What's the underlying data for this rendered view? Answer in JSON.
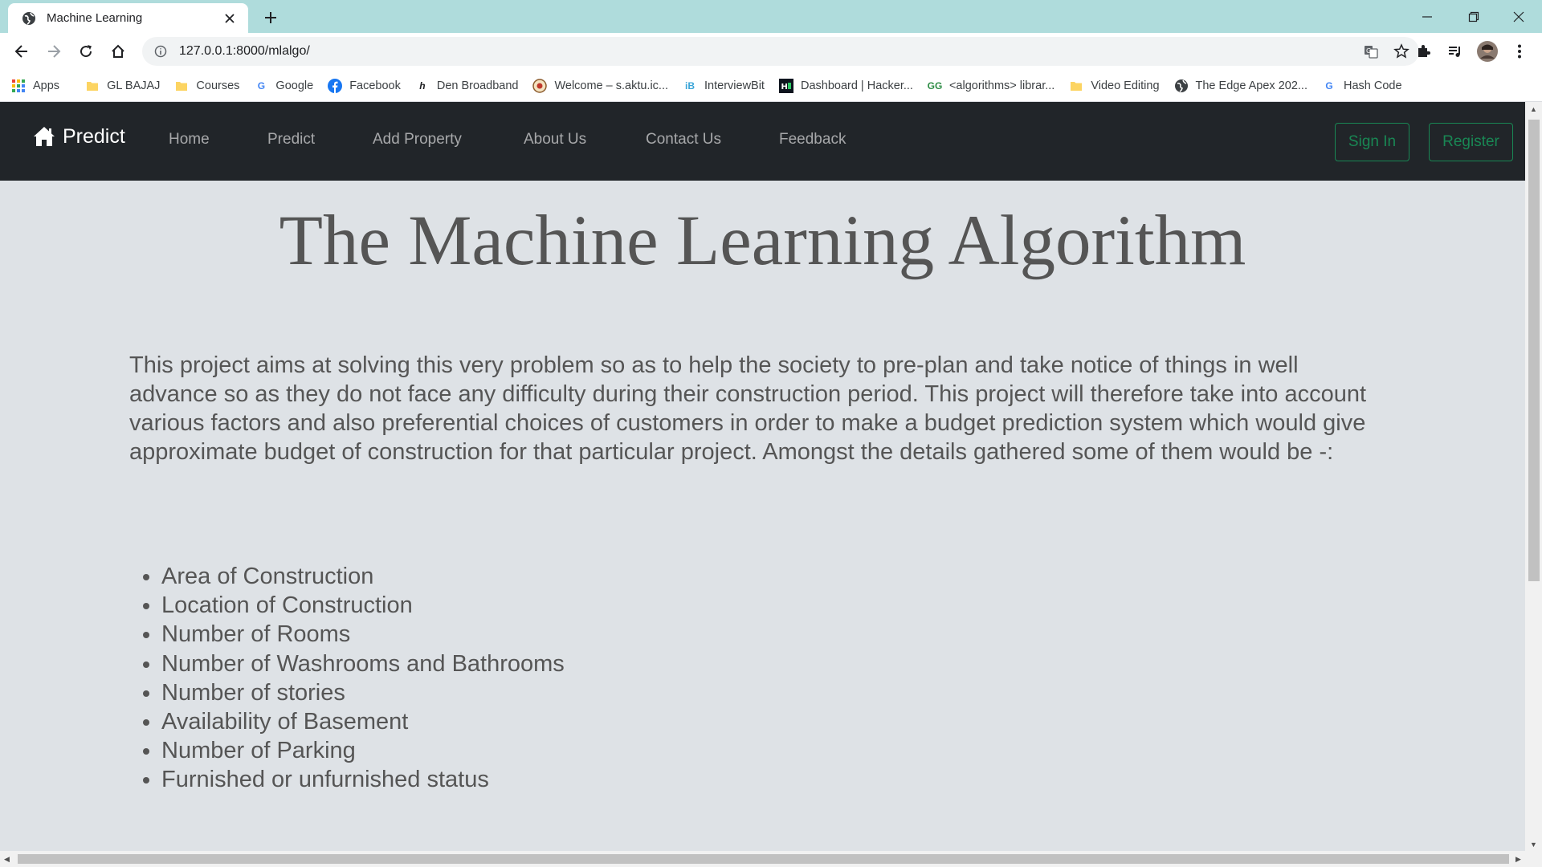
{
  "browser": {
    "tab_title": "Machine Learning",
    "url": "127.0.0.1:8000/mlalgo/",
    "bookmarks": [
      {
        "label": "Apps",
        "icon": "apps-grid-icon"
      },
      {
        "label": "GL BAJAJ",
        "icon": "folder-icon"
      },
      {
        "label": "Courses",
        "icon": "folder-icon"
      },
      {
        "label": "Google",
        "icon": "google-icon"
      },
      {
        "label": "Facebook",
        "icon": "facebook-icon"
      },
      {
        "label": "Den Broadband",
        "icon": "den-icon"
      },
      {
        "label": "Welcome – s.aktu.ic...",
        "icon": "aktu-icon"
      },
      {
        "label": "InterviewBit",
        "icon": "interviewbit-icon"
      },
      {
        "label": "Dashboard | Hacker...",
        "icon": "hackerrank-icon"
      },
      {
        "label": "<algorithms> librar...",
        "icon": "gfg-icon"
      },
      {
        "label": "Video Editing",
        "icon": "folder-icon"
      },
      {
        "label": "The Edge Apex 202...",
        "icon": "globe-icon"
      },
      {
        "label": "Hash Code",
        "icon": "google-icon"
      }
    ]
  },
  "navbar": {
    "brand": "Predict",
    "links": [
      "Home",
      "Predict",
      "Add Property",
      "About Us",
      "Contact Us",
      "Feedback"
    ],
    "signin": "Sign In",
    "register": "Register"
  },
  "main": {
    "title": "The Machine Learning Algorithm",
    "intro": "This project aims at solving this very problem so as to help the society to pre-plan and take notice of things in well advance so as they do not face any difficulty during their construction period. This project will therefore take into account various factors and also preferential choices of customers in order to make a budget prediction system which would give approximate budget of construction for that particular project. Amongst the details gathered some of them would be -:",
    "features": [
      "Area of Construction",
      "Location of Construction",
      "Number of Rooms",
      "Number of Washrooms and Bathrooms",
      "Number of stories",
      "Availability of Basement",
      "Number of Parking",
      "Furnished or unfurnished status"
    ]
  },
  "colors": {
    "navbar_bg": "#212529",
    "page_bg": "#dee2e6",
    "success": "#198754",
    "text": "#555555",
    "tabstrip": "#afdcdc"
  }
}
